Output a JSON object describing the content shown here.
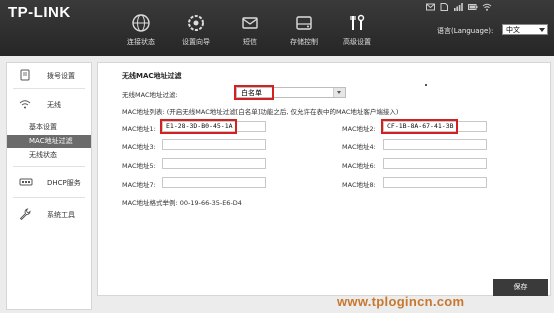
{
  "brand": {
    "logo": "TP-LINK"
  },
  "nav": {
    "items": [
      {
        "label": "连接状态",
        "icon": "globe-icon"
      },
      {
        "label": "设置向导",
        "icon": "wizard-icon"
      },
      {
        "label": "短信",
        "icon": "mail-icon"
      },
      {
        "label": "存储控制",
        "icon": "storage-icon"
      },
      {
        "label": "高级设置",
        "icon": "tools-icon"
      }
    ],
    "language_label": "语言(Language):",
    "language_value": "中文",
    "status_icons": [
      "envelope-icon",
      "sim-icon",
      "signal-icon",
      "battery-icon",
      "wifi-icon"
    ]
  },
  "sidebar": {
    "items": [
      {
        "label": "拨号设置",
        "icon": "dialup-icon"
      },
      {
        "label": "无线",
        "icon": "wifi-icon"
      },
      {
        "label": "DHCP服务",
        "icon": "dhcp-icon"
      },
      {
        "label": "系统工具",
        "icon": "wrench-icon"
      }
    ],
    "subitems": [
      {
        "label": "基本设置"
      },
      {
        "label": "MAC地址过滤"
      },
      {
        "label": "无线状态"
      }
    ]
  },
  "main": {
    "section_title": "无线MAC地址过滤",
    "filter_label": "无线MAC地址过滤:",
    "filter_value": "白名单",
    "mac_list_label": "MAC地址列表: (开启无线MAC地址过滤[白名单]功能之后, 仅允许在表中的MAC地址客户端接入)",
    "fields": [
      {
        "label": "MAC地址1:",
        "value": "E1-28-3D-B0-45-1A"
      },
      {
        "label": "MAC地址2:",
        "value": "CF-1B-8A-67-41-3B"
      },
      {
        "label": "MAC地址3:",
        "value": ""
      },
      {
        "label": "MAC地址4:",
        "value": ""
      },
      {
        "label": "MAC地址5:",
        "value": ""
      },
      {
        "label": "MAC地址6:",
        "value": ""
      },
      {
        "label": "MAC地址7:",
        "value": ""
      },
      {
        "label": "MAC地址8:",
        "value": ""
      }
    ],
    "format_example": "MAC地址格式举例: 00-19-66-35-E6-D4",
    "save_label": "保存"
  },
  "watermark": "www.tplogincn.com",
  "colors": {
    "header_bg": "#2e2e2e",
    "highlight": "#d32020",
    "active_sub": "#6b6b6b",
    "watermark": "#c8782e"
  }
}
